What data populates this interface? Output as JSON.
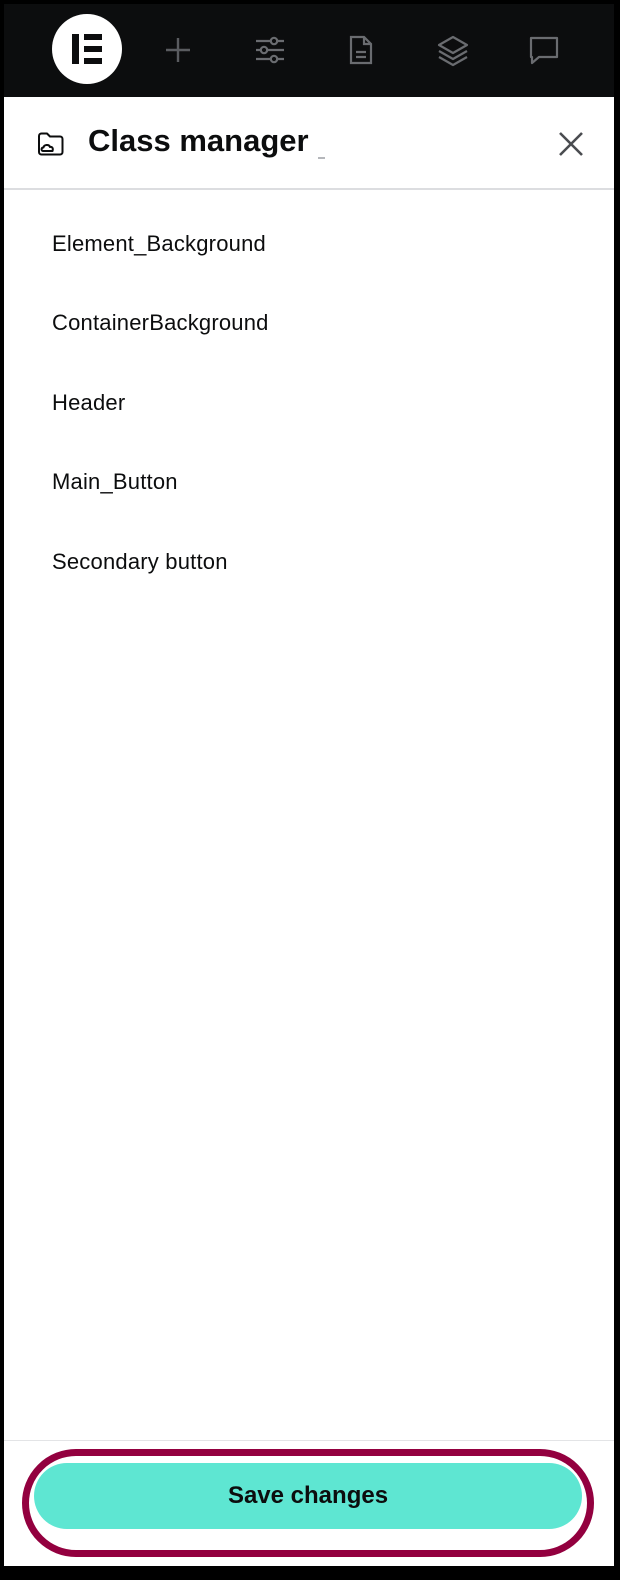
{
  "topbar": {
    "logo_icon": "elementor-logo-icon",
    "icons": [
      "plus-icon",
      "sliders-icon",
      "document-icon",
      "layers-icon",
      "chat-icon"
    ]
  },
  "header": {
    "icon": "folder-cloud-icon",
    "title": "Class manager"
  },
  "classes": [
    "Element_Background",
    "ContainerBackground",
    "Header",
    "Main_Button",
    "Secondary button"
  ],
  "footer": {
    "save_label": "Save changes"
  },
  "colors": {
    "topbar": "#0c0d0e",
    "save_button": "#5ee6d2",
    "highlight_ring": "#93003f"
  }
}
